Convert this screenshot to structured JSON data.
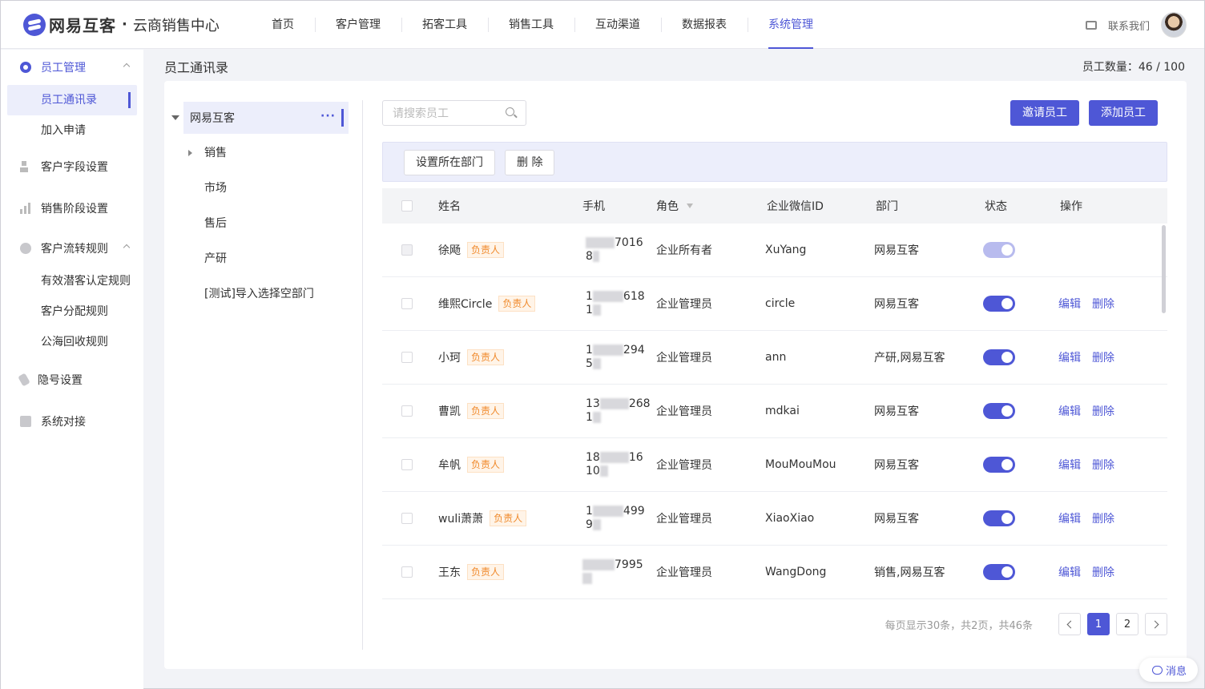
{
  "brand": {
    "name": "网易互客",
    "dot": "·",
    "subtitle": "云商销售中心"
  },
  "nav": [
    {
      "label": "首页",
      "active": false
    },
    {
      "label": "客户管理",
      "active": false
    },
    {
      "label": "拓客工具",
      "active": false
    },
    {
      "label": "销售工具",
      "active": false
    },
    {
      "label": "互动渠道",
      "active": false
    },
    {
      "label": "数据报表",
      "active": false
    },
    {
      "label": "系统管理",
      "active": true
    }
  ],
  "header": {
    "contact_label": "联系我们"
  },
  "sidebar": {
    "groups": [
      {
        "label": "员工管理",
        "icon": "gear-icon",
        "open": true,
        "items": [
          {
            "label": "员工通讯录",
            "active": true
          },
          {
            "label": "加入申请",
            "active": false
          }
        ]
      },
      {
        "label": "客户字段设置",
        "icon": "person-icon"
      },
      {
        "label": "销售阶段设置",
        "icon": "bar-chart-icon"
      },
      {
        "label": "客户流转规则",
        "icon": "flow-icon",
        "open": true,
        "items": [
          {
            "label": "有效潜客认定规则"
          },
          {
            "label": "客户分配规则"
          },
          {
            "label": "公海回收规则"
          }
        ]
      },
      {
        "label": "隐号设置",
        "icon": "phone-icon"
      },
      {
        "label": "系统对接",
        "icon": "plug-icon"
      }
    ]
  },
  "page": {
    "title": "员工通讯录",
    "employee_count": "员工数量：46 / 100"
  },
  "tree": {
    "root": "网易互客",
    "more": "···",
    "nodes": [
      "销售",
      "市场",
      "售后",
      "产研",
      "[测试]导入选择空部门"
    ]
  },
  "search": {
    "placeholder": "请搜索员工",
    "value": ""
  },
  "actions": {
    "invite": "邀请员工",
    "add": "添加员工"
  },
  "bulk": {
    "set_department": "设置所在部门",
    "delete": "删 除"
  },
  "table": {
    "columns": {
      "name": "姓名",
      "phone": "手机",
      "role": "角色",
      "wechat_id": "企业微信ID",
      "department": "部门",
      "status": "状态",
      "actions": "操作"
    },
    "owner_tag": "负责人",
    "edit": "编辑",
    "delete": "删除",
    "rows": [
      {
        "name": "徐飏",
        "phone_line1": "7016",
        "phone_line2": "8",
        "role": "企业所有者",
        "wechat_id": "XuYang",
        "department": "网易互客",
        "status_on": true,
        "status_disabled": true,
        "editable": false
      },
      {
        "name": "维熙Circle",
        "phone_line1": "1",
        "phone_line1_end": "618",
        "phone_line2": "1",
        "role": "企业管理员",
        "wechat_id": "circle",
        "department": "网易互客",
        "status_on": true,
        "editable": true
      },
      {
        "name": "小珂",
        "phone_line1": "1",
        "phone_line1_end": "294",
        "phone_line2": "5",
        "role": "企业管理员",
        "wechat_id": "ann",
        "department": "产研,网易互客",
        "status_on": true,
        "editable": true
      },
      {
        "name": "曹凯",
        "phone_line1": "13",
        "phone_line1_end": "268",
        "phone_line2": "1",
        "role": "企业管理员",
        "wechat_id": "mdkai",
        "department": "网易互客",
        "status_on": true,
        "editable": true
      },
      {
        "name": "牟帆",
        "phone_line1": "18",
        "phone_line1_end": "16",
        "phone_line2": "10",
        "role": "企业管理员",
        "wechat_id": "MouMouMou",
        "department": "网易互客",
        "status_on": true,
        "editable": true
      },
      {
        "name": "wuli萧萧",
        "phone_line1": "1",
        "phone_line1_end": "499",
        "phone_line2": "9",
        "role": "企业管理员",
        "wechat_id": "XiaoXiao",
        "department": "网易互客",
        "status_on": true,
        "editable": true
      },
      {
        "name": "王东",
        "phone_line1": "7995",
        "phone_line2": "",
        "role": "企业管理员",
        "wechat_id": "WangDong",
        "department": "销售,网易互客",
        "status_on": true,
        "editable": true
      }
    ]
  },
  "pagination": {
    "info": "每页显示30条，共2页，共46条",
    "pages": [
      "1",
      "2"
    ],
    "current": "1"
  },
  "floating": {
    "message_label": "消息"
  },
  "colors": {
    "accent": "#4e57d6",
    "tag_text": "#f08a2c",
    "tag_bg": "#fff4e8"
  }
}
